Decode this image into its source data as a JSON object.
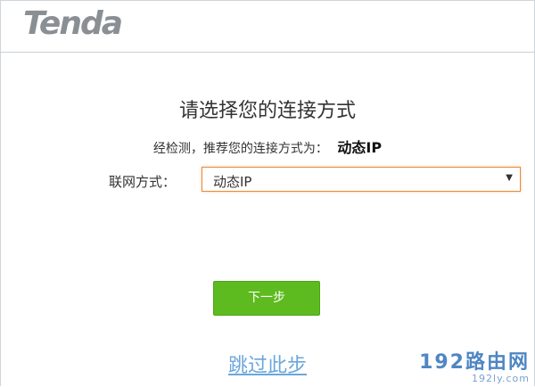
{
  "header": {
    "logo_text": "Tenda"
  },
  "main": {
    "title": "请选择您的连接方式",
    "detect_text": "经检测，推荐您的连接方式为：",
    "detect_result": "动态IP",
    "connection_label": "联网方式：",
    "connection_select": {
      "selected": "动态IP"
    },
    "next_label": "下一步",
    "skip_label": "跳过此步"
  },
  "watermark": {
    "main": "192路由网",
    "sub": "192ly.com"
  },
  "colors": {
    "accent_green": "#5dbb1f",
    "select_border": "#e98a3a",
    "link_blue": "#6aa7dc"
  },
  "icons": {
    "select_arrow": "caret-down-icon"
  }
}
